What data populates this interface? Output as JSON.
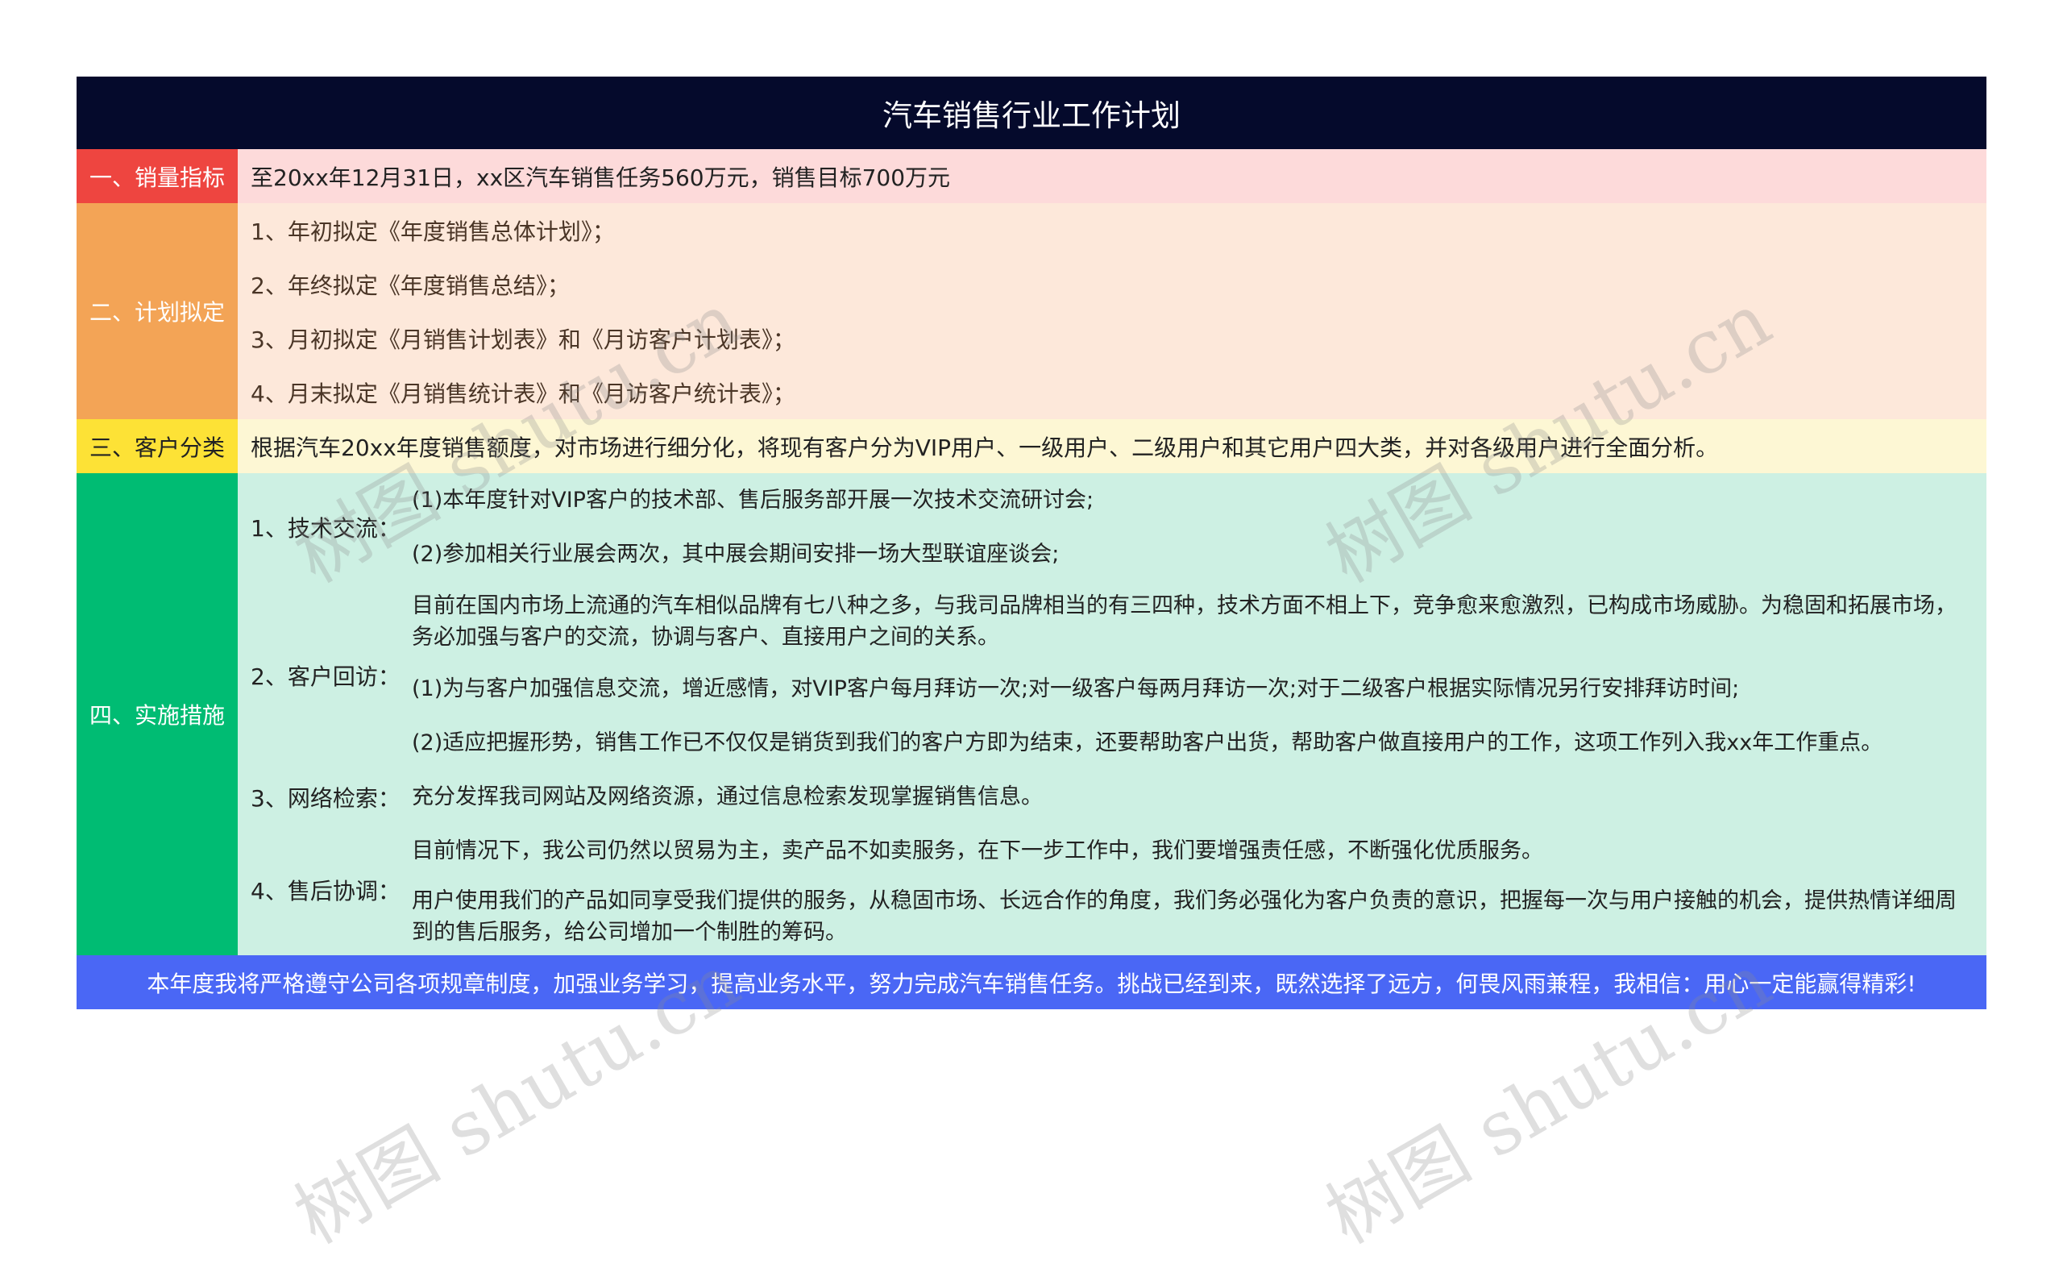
{
  "title": "汽车销售行业工作计划",
  "sections": {
    "sales_target": {
      "label": "一、销量指标",
      "text": "至20xx年12月31日，xx区汽车销售任务560万元，销售目标700万元"
    },
    "planning": {
      "label": "二、计划拟定",
      "items": [
        "1、年初拟定《年度销售总体计划》；",
        "2、年终拟定《年度销售总结》；",
        "3、月初拟定《月销售计划表》和《月访客户计划表》；",
        "4、月末拟定《月销售统计表》和《月访客户统计表》；"
      ]
    },
    "classification": {
      "label": "三、客户分类",
      "text": "根据汽车20xx年度销售额度，对市场进行细分化，将现有客户分为VIP用户、一级用户、二级用户和其它用户四大类，并对各级用户进行全面分析。"
    },
    "measures": {
      "label": "四、实施措施",
      "groups": [
        {
          "label": "1、技术交流：",
          "items": [
            "(1)本年度针对VIP客户的技术部、售后服务部开展一次技术交流研讨会;",
            "(2)参加相关行业展会两次，其中展会期间安排一场大型联谊座谈会;"
          ]
        },
        {
          "label": "2、客户回访：",
          "items": [
            "目前在国内市场上流通的汽车相似品牌有七八种之多，与我司品牌相当的有三四种，技术方面不相上下，竞争愈来愈激烈，已构成市场威胁。为稳固和拓展市场，务必加强与客户的交流，协调与客户、直接用户之间的关系。",
            "(1)为与客户加强信息交流，增近感情，对VIP客户每月拜访一次;对一级客户每两月拜访一次;对于二级客户根据实际情况另行安排拜访时间;",
            "(2)适应把握形势，销售工作已不仅仅是销货到我们的客户方即为结束，还要帮助客户出货，帮助客户做直接用户的工作，这项工作列入我xx年工作重点。"
          ]
        },
        {
          "label": "3、网络检索：",
          "items": [
            "充分发挥我司网站及网络资源，通过信息检索发现掌握销售信息。"
          ]
        },
        {
          "label": "4、售后协调：",
          "items": [
            "目前情况下，我公司仍然以贸易为主，卖产品不如卖服务，在下一步工作中，我们要增强责任感，不断强化优质服务。",
            "用户使用我们的产品如同享受我们提供的服务，从稳固市场、长远合作的角度，我们务必强化为客户负责的意识，把握每一次与用户接触的机会，提供热情详细周到的售后服务，给公司增加一个制胜的筹码。"
          ]
        }
      ]
    }
  },
  "footer": "本年度我将严格遵守公司各项规章制度，加强业务学习，提高业务水平，努力完成汽车销售任务。挑战已经到来，既然选择了远方，何畏风雨兼程，我相信：用心一定能赢得精彩!",
  "watermark": "树图 shutu.cn",
  "colors": {
    "title_bg": "#050a2c",
    "sales_label": "#ee4540",
    "sales_bg": "#fddada",
    "plan_label": "#f3a456",
    "plan_bg": "#fde8da",
    "class_label": "#fde236",
    "class_bg": "#fdf7d4",
    "measures_label": "#00bc73",
    "measures_bg": "#cdf0e3",
    "footer_bg": "#4a67f5"
  }
}
